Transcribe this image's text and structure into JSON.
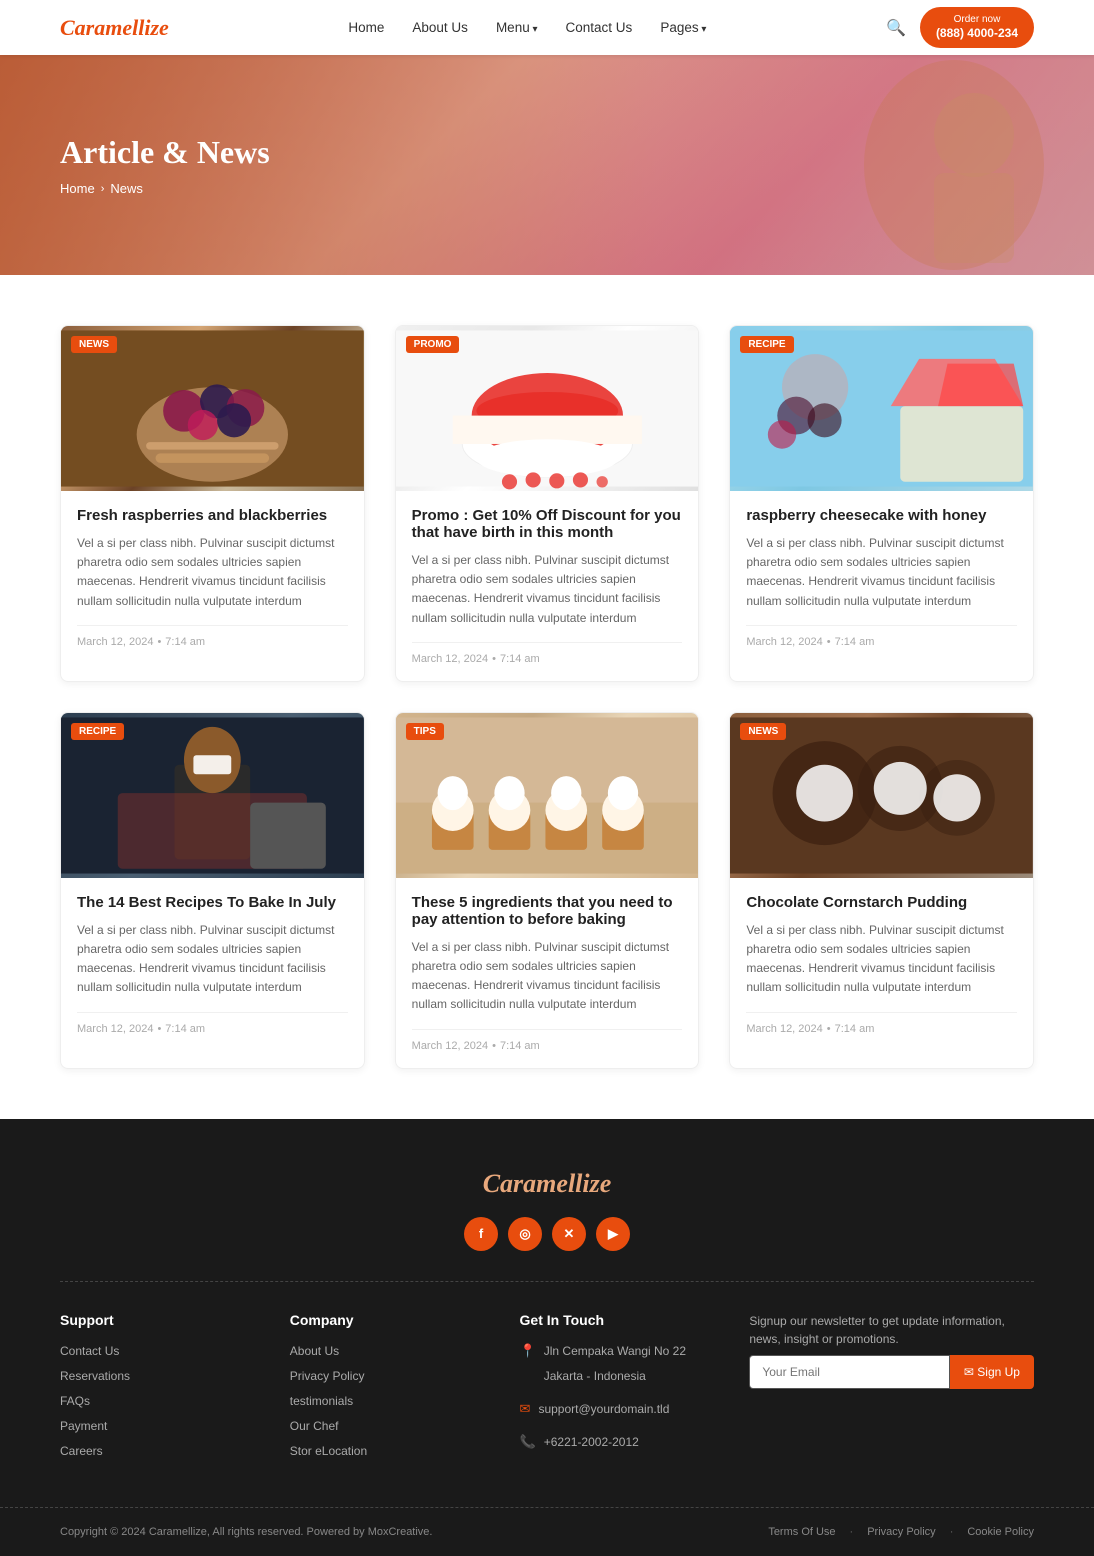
{
  "brand": {
    "name": "Caramellize",
    "phone_label": "Order now",
    "phone_number": "(888) 4000-234"
  },
  "nav": {
    "links": [
      {
        "label": "Home",
        "has_dropdown": false
      },
      {
        "label": "About Us",
        "has_dropdown": false
      },
      {
        "label": "Menu",
        "has_dropdown": true
      },
      {
        "label": "Contact Us",
        "has_dropdown": false
      },
      {
        "label": "Pages",
        "has_dropdown": true
      }
    ]
  },
  "hero": {
    "title": "Article & News",
    "breadcrumb_home": "Home",
    "breadcrumb_current": "News"
  },
  "articles": [
    {
      "badge": "NEWS",
      "img_class": "img-berries",
      "title": "Fresh raspberries and blackberries",
      "desc": "Vel a si per class nibh. Pulvinar suscipit dictumst pharetra odio sem sodales ultricies sapien maecenas. Hendrerit vivamus tincidunt facilisis nullam sollicitudin nulla vulputate interdum",
      "date": "March 12, 2024",
      "time": "7:14 am"
    },
    {
      "badge": "PROMO",
      "img_class": "img-strawberry",
      "title": "Promo : Get 10% Off Discount for you that have birth in this month",
      "desc": "Vel a si per class nibh. Pulvinar suscipit dictumst pharetra odio sem sodales ultricies sapien maecenas. Hendrerit vivamus tincidunt facilisis nullam sollicitudin nulla vulputate interdum",
      "date": "March 12, 2024",
      "time": "7:14 am"
    },
    {
      "badge": "RECIPE",
      "img_class": "img-raspberry",
      "title": "raspberry cheesecake with honey",
      "desc": "Vel a si per class nibh. Pulvinar suscipit dictumst pharetra odio sem sodales ultricies sapien maecenas. Hendrerit vivamus tincidunt facilisis nullam sollicitudin nulla vulputate interdum",
      "date": "March 12, 2024",
      "time": "7:14 am"
    },
    {
      "badge": "RECIPE",
      "img_class": "img-chef",
      "title": "The 14 Best Recipes To Bake In July",
      "desc": "Vel a si per class nibh. Pulvinar suscipit dictumst pharetra odio sem sodales ultricies sapien maecenas. Hendrerit vivamus tincidunt facilisis nullam sollicitudin nulla vulputate interdum",
      "date": "March 12, 2024",
      "time": "7:14 am"
    },
    {
      "badge": "TIPS",
      "img_class": "img-cupcakes",
      "title": "These 5 ingredients that you need to pay attention to before baking",
      "desc": "Vel a si per class nibh. Pulvinar suscipit dictumst pharetra odio sem sodales ultricies sapien maecenas. Hendrerit vivamus tincidunt facilisis nullam sollicitudin nulla vulputate interdum",
      "date": "March 12, 2024",
      "time": "7:14 am"
    },
    {
      "badge": "NEWS",
      "img_class": "img-pudding",
      "title": "Chocolate Cornstarch Pudding",
      "desc": "Vel a si per class nibh. Pulvinar suscipit dictumst pharetra odio sem sodales ultricies sapien maecenas. Hendrerit vivamus tincidunt facilisis nullam sollicitudin nulla vulputate interdum",
      "date": "March 12, 2024",
      "time": "7:14 am"
    }
  ],
  "footer": {
    "brand_name": "Caramellize",
    "socials": [
      {
        "name": "facebook",
        "label": "f"
      },
      {
        "name": "instagram",
        "label": "📷"
      },
      {
        "name": "twitter-x",
        "label": "✕"
      },
      {
        "name": "youtube",
        "label": "▶"
      }
    ],
    "support": {
      "heading": "Support",
      "links": [
        "Contact Us",
        "Reservations",
        "FAQs",
        "Payment",
        "Careers"
      ]
    },
    "company": {
      "heading": "Company",
      "links": [
        "About Us",
        "Privacy Policy",
        "testimonials",
        "Our Chef",
        "Stor eLocation"
      ]
    },
    "contact": {
      "heading": "Get In Touch",
      "address_line1": "Jln Cempaka Wangi No 22",
      "address_line2": "Jakarta - Indonesia",
      "email": "support@yourdomain.tld",
      "phone": "+6221-2002-2012"
    },
    "newsletter": {
      "heading": "Signup our newsletter to get update information, news, insight or promotions.",
      "placeholder": "Your Email",
      "btn_label": "✉ Sign Up"
    },
    "legal": {
      "copyright": "Copyright © 2024 Caramellize, All rights reserved. Powered by MoxCreative.",
      "links": [
        "Terms Of Use",
        "Privacy Policy",
        "Cookie Policy"
      ]
    }
  }
}
